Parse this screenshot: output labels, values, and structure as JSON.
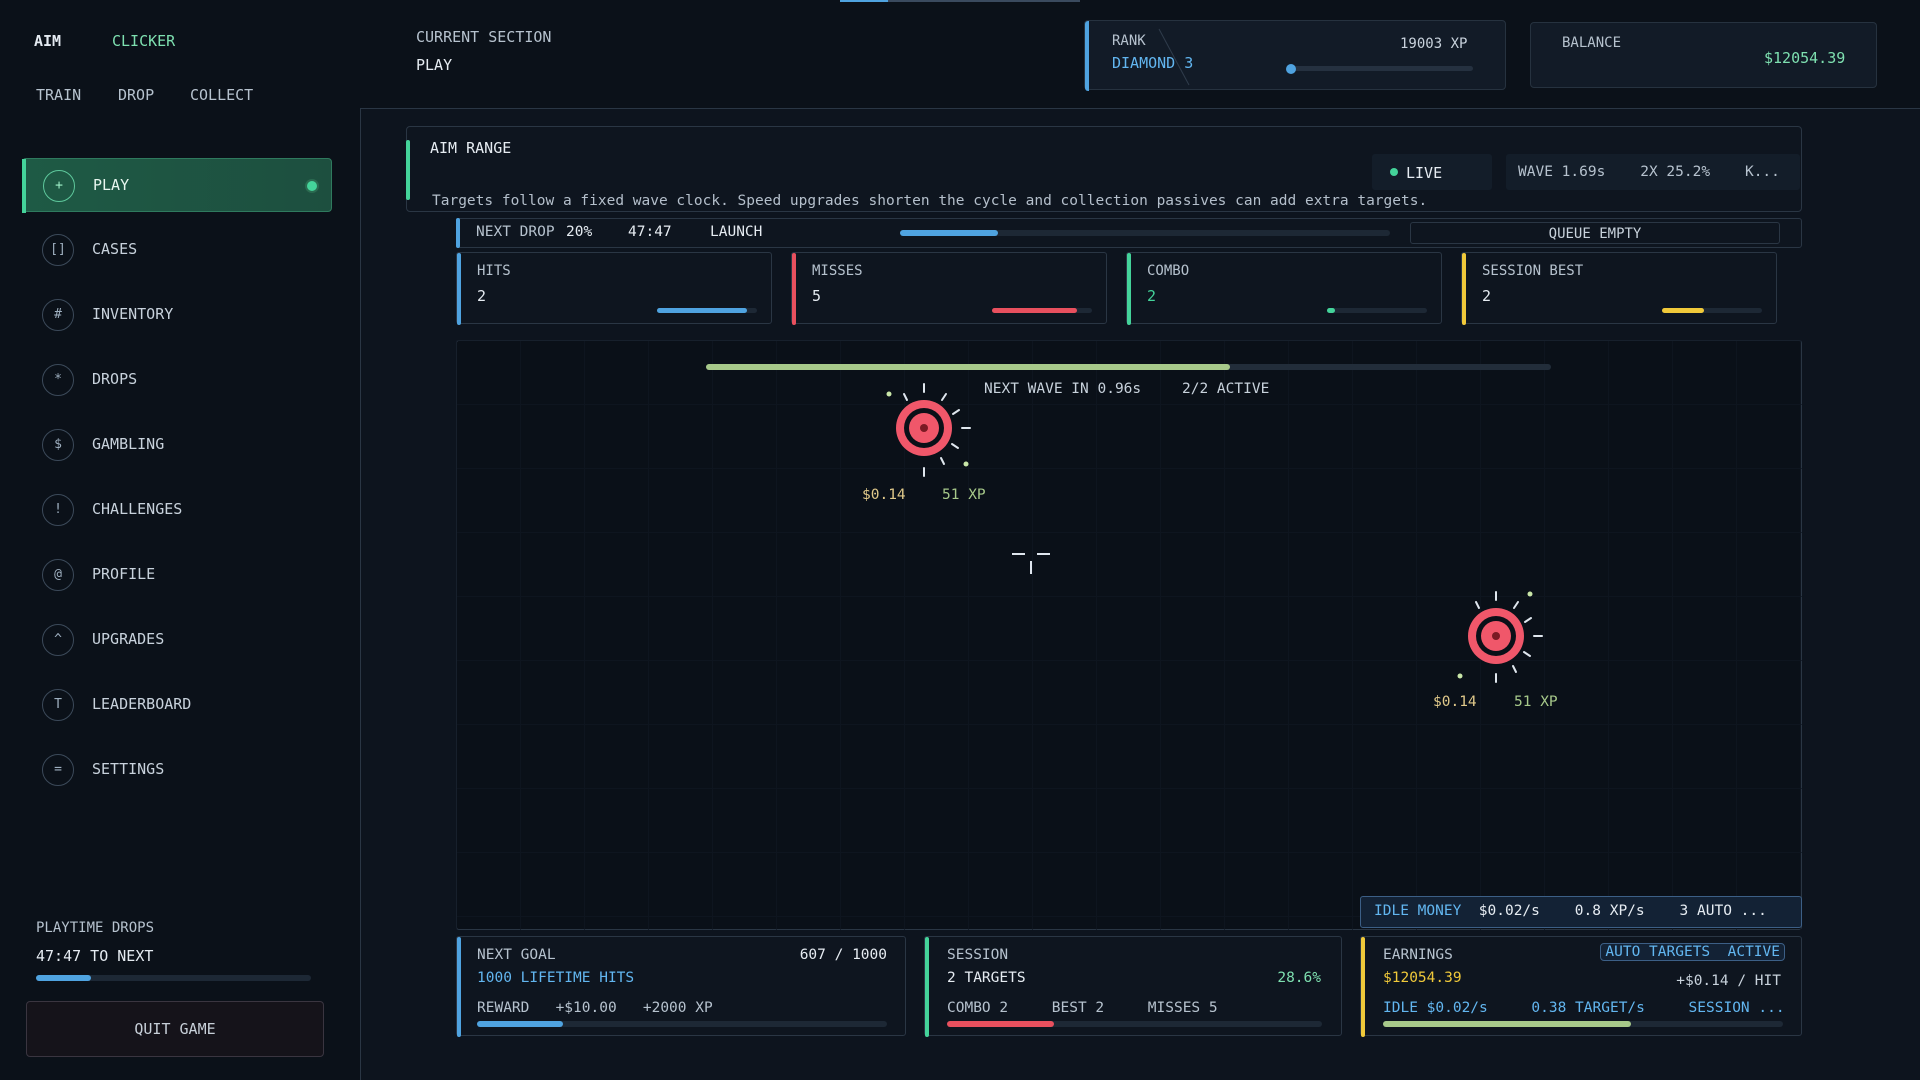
{
  "brand": {
    "aim": "AIM",
    "clicker": "CLICKER"
  },
  "subnav": [
    "TRAIN",
    "DROP",
    "COLLECT"
  ],
  "nav": [
    {
      "icon": "+",
      "icon_name": "plus-icon",
      "label": "PLAY",
      "active": true
    },
    {
      "icon": "[]",
      "icon_name": "case-icon",
      "label": "CASES"
    },
    {
      "icon": "#",
      "icon_name": "hash-icon",
      "label": "INVENTORY"
    },
    {
      "icon": "*",
      "icon_name": "star-icon",
      "label": "DROPS"
    },
    {
      "icon": "$",
      "icon_name": "dollar-icon",
      "label": "GAMBLING"
    },
    {
      "icon": "!",
      "icon_name": "alert-icon",
      "label": "CHALLENGES"
    },
    {
      "icon": "@",
      "icon_name": "at-icon",
      "label": "PROFILE"
    },
    {
      "icon": "^",
      "icon_name": "caret-up-icon",
      "label": "UPGRADES"
    },
    {
      "icon": "T",
      "icon_name": "trophy-icon",
      "label": "LEADERBOARD"
    },
    {
      "icon": "=",
      "icon_name": "menu-icon",
      "label": "SETTINGS"
    }
  ],
  "playtime": {
    "label": "PLAYTIME DROPS",
    "value": "47:47 TO NEXT",
    "progress": 0.2
  },
  "quit_label": "QUIT GAME",
  "header": {
    "section_label": "CURRENT SECTION",
    "section_value": "PLAY",
    "rank_label": "RANK",
    "rank_value": "DIAMOND 3",
    "xp": "19003 XP",
    "rank_progress": 0.02,
    "balance_label": "BALANCE",
    "balance_value": "$12054.39"
  },
  "aim_range": {
    "title": "AIM RANGE",
    "description": "Targets follow a fixed wave clock. Speed upgrades shorten the cycle and collection passives can add extra targets.",
    "live": "LIVE",
    "wave_stats": "WAVE 1.69s    2X 25.2%    K..."
  },
  "next_drop": {
    "label": "NEXT DROP",
    "pct": "20%",
    "time": "47:47",
    "launch": "LAUNCH",
    "progress": 0.2,
    "queue": "QUEUE EMPTY"
  },
  "stats": [
    {
      "label": "HITS",
      "value": "2",
      "color": "#4fa3e0",
      "progress": 0.9
    },
    {
      "label": "MISSES",
      "value": "5",
      "color": "#e8505e",
      "progress": 0.85
    },
    {
      "label": "COMBO",
      "value": "2",
      "color": "#44d39a",
      "progress": 0.08
    },
    {
      "label": "SESSION BEST",
      "value": "2",
      "color": "#f0c93a",
      "progress": 0.42
    }
  ],
  "game": {
    "wave_info": "NEXT WAVE IN 0.96s",
    "active": "2/2 ACTIVE",
    "wave_progress": 0.62,
    "targets": [
      {
        "money": "$0.14",
        "xp": "51 XP"
      },
      {
        "money": "$0.14",
        "xp": "51 XP"
      }
    ],
    "target_color": "#f0576a"
  },
  "idle": {
    "label": "IDLE MONEY",
    "rest": "  $0.02/s    0.8 XP/s    3 AUTO ..."
  },
  "bottom": {
    "goal": {
      "label": "NEXT GOAL",
      "count": "607 / 1000",
      "title": "1000 LIFETIME HITS",
      "reward": "REWARD   +$10.00   +2000 XP",
      "progress": 0.21
    },
    "session": {
      "label": "SESSION",
      "targets": "2 TARGETS",
      "pct": "28.6%",
      "detail": "COMBO 2     BEST 2     MISSES 5",
      "progress": 0.286
    },
    "earnings": {
      "label": "EARNINGS",
      "badge": "AUTO TARGETS  ACTIVE",
      "value": "$12054.39",
      "per_hit": "+$0.14 / HIT",
      "detail": "IDLE $0.02/s     0.38 TARGET/s     SESSION ...",
      "progress": 0.62
    }
  },
  "colors": {
    "accent_green": "#44d39a",
    "accent_blue": "#4fa3e0",
    "accent_red": "#e8505e",
    "accent_yellow": "#f0c93a",
    "background": "#0b1119"
  }
}
